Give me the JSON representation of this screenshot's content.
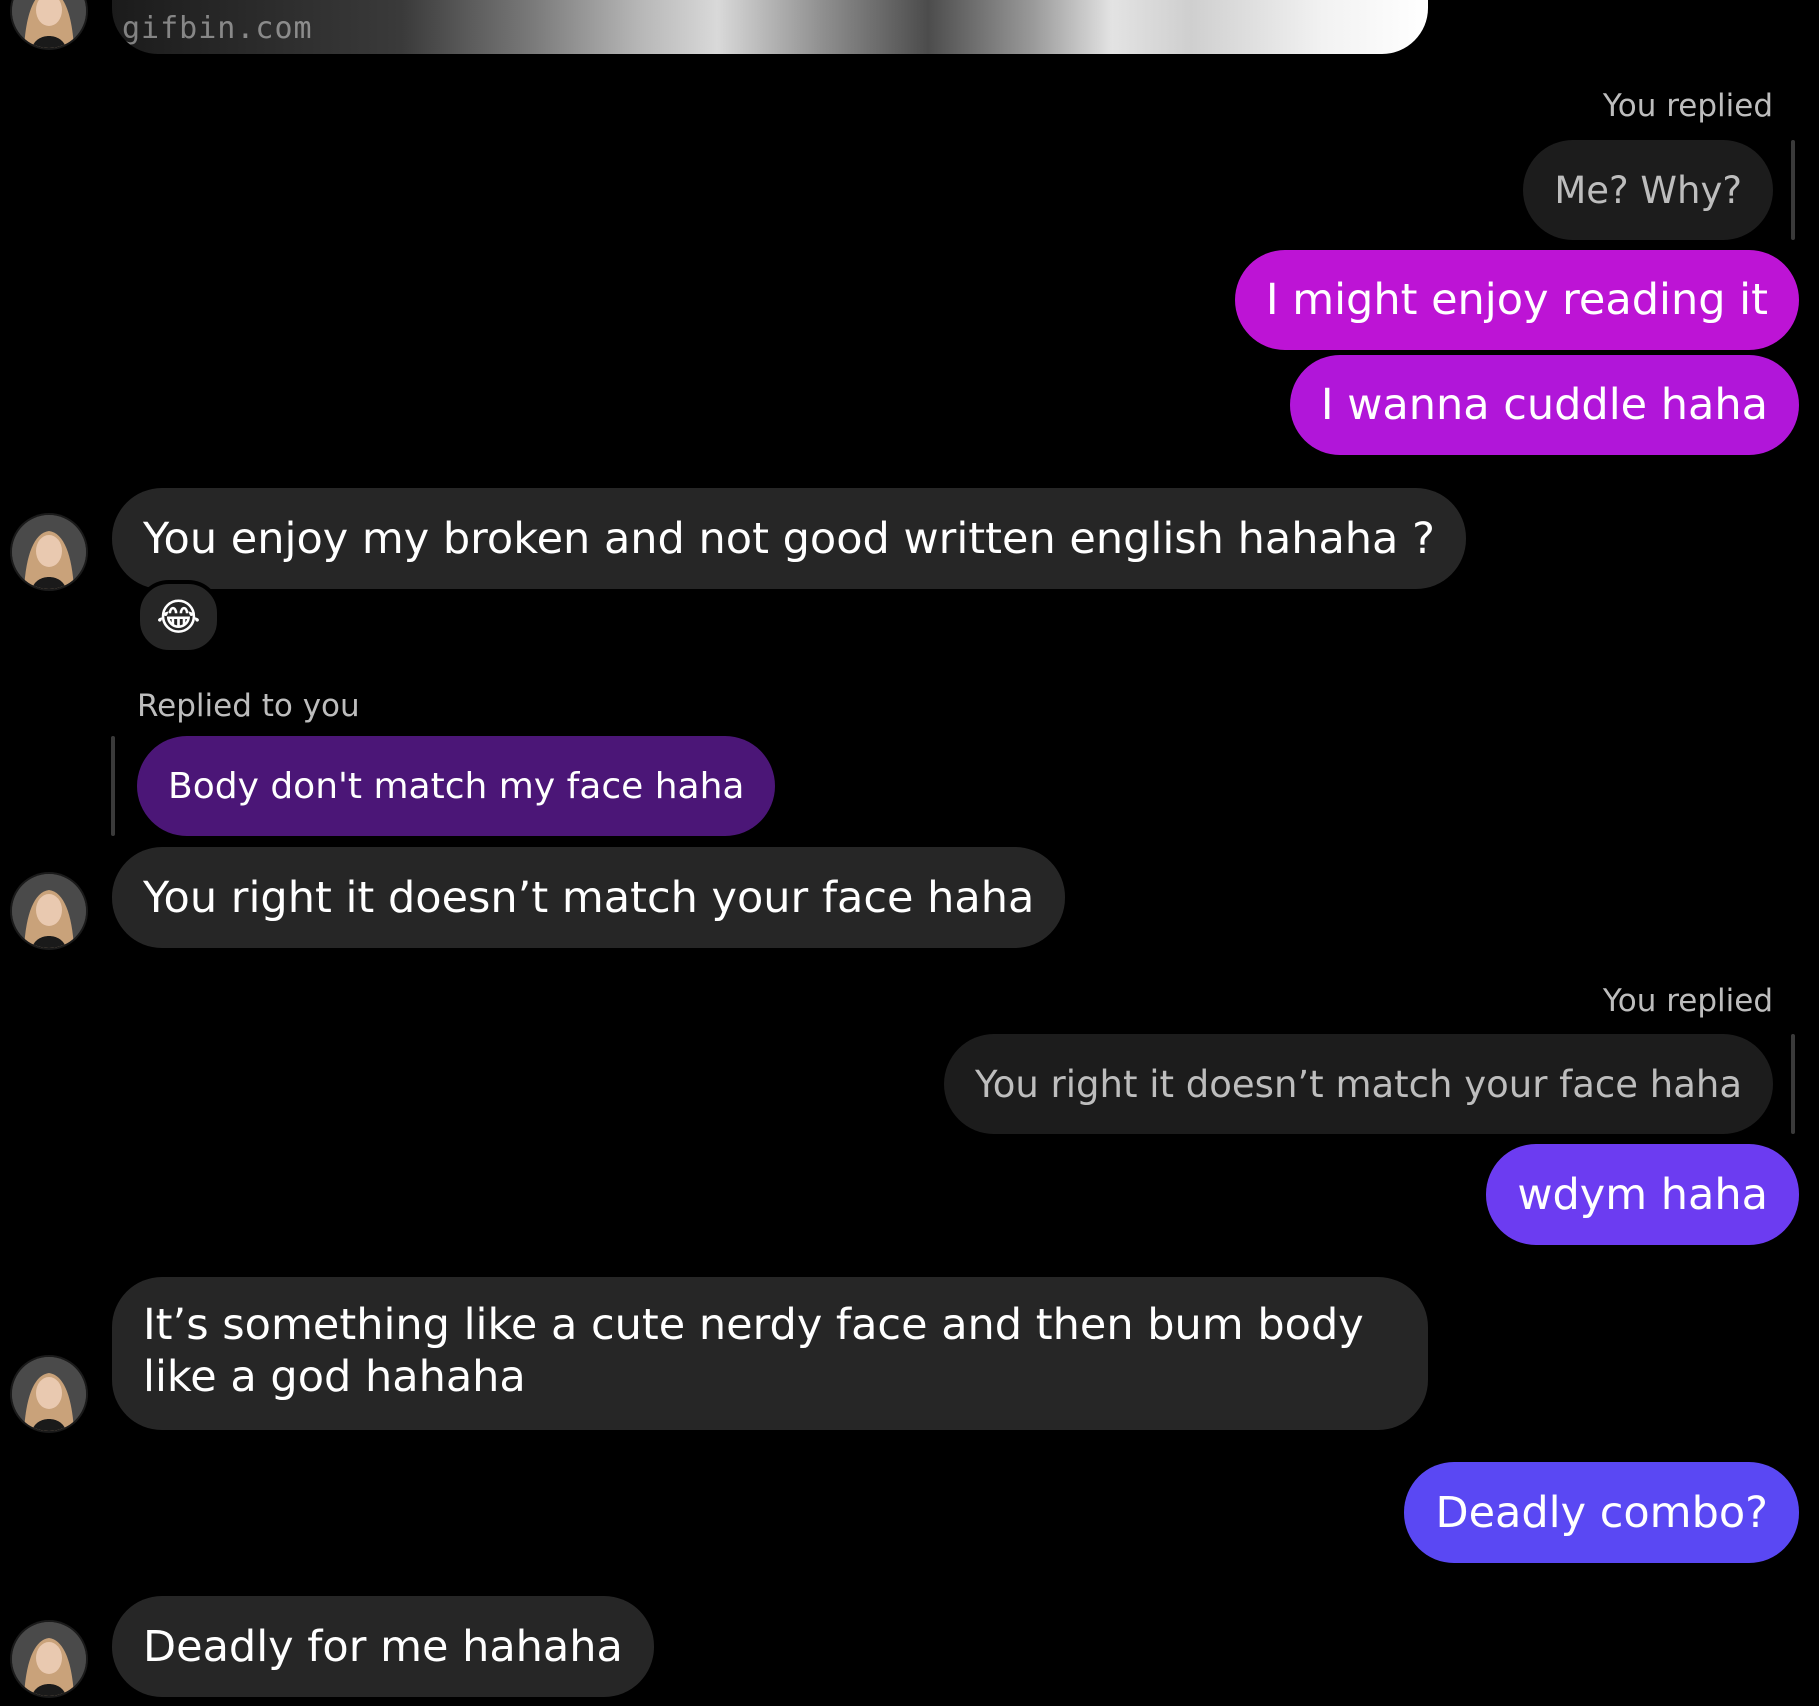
{
  "gif": {
    "watermark": "gifbin.com"
  },
  "colors": {
    "background": "#000000",
    "received_bubble": "#262626",
    "sent_bubble_gradient": [
      "#c114d3",
      "#a21ee8",
      "#6e39f0",
      "#5a48f3"
    ],
    "quoted_received_bubble": "#4b1677"
  },
  "messages": [
    {
      "id": "reply1",
      "direction": "sent",
      "meta": "You replied",
      "quoted": "Me? Why?"
    },
    {
      "id": "m1",
      "direction": "sent",
      "text": "I might enjoy reading it"
    },
    {
      "id": "m2",
      "direction": "sent",
      "text": "I wanna cuddle haha"
    },
    {
      "id": "m3",
      "direction": "received",
      "text": "You enjoy my broken and not good written english hahaha ?",
      "reaction": "😂"
    },
    {
      "id": "reply2",
      "direction": "received",
      "meta": "Replied to you",
      "quoted": "Body don't match my face haha"
    },
    {
      "id": "m4",
      "direction": "received",
      "text": "You right it doesn’t match your face haha"
    },
    {
      "id": "reply3",
      "direction": "sent",
      "meta": "You replied",
      "quoted": "You right it doesn’t match your face haha"
    },
    {
      "id": "m5",
      "direction": "sent",
      "text": "wdym haha"
    },
    {
      "id": "m6",
      "direction": "received",
      "text": "It’s something like a cute nerdy face and then bum body like a god hahaha"
    },
    {
      "id": "m7",
      "direction": "sent",
      "text": "Deadly combo?"
    },
    {
      "id": "m8",
      "direction": "received",
      "text": "Deadly for me hahaha"
    }
  ]
}
